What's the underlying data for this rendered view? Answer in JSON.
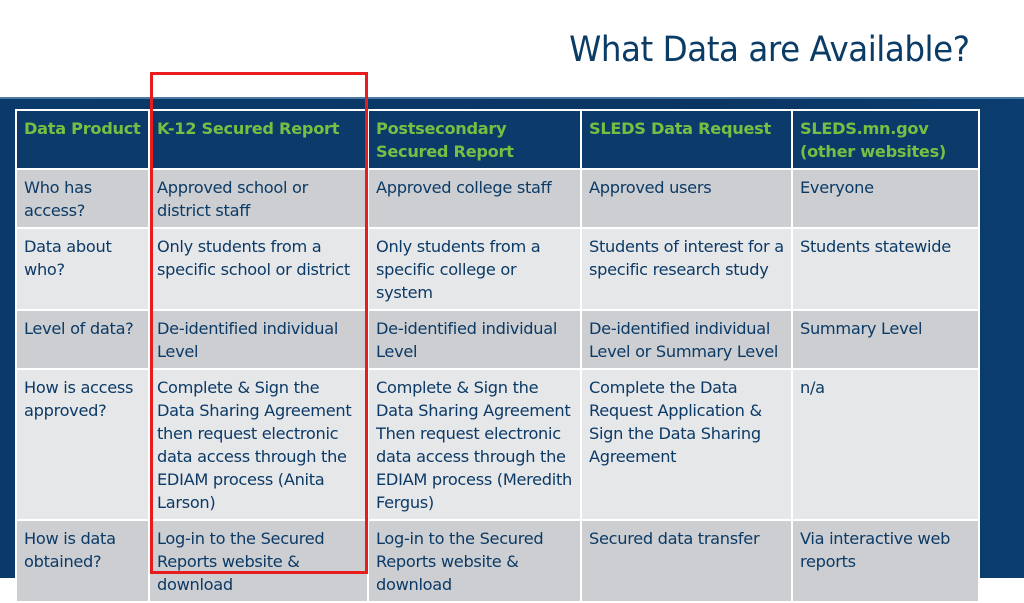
{
  "slide": {
    "title": "What Data are Available?"
  },
  "colors": {
    "title_text": "#0b3c66",
    "band_background": "#0a3a6a",
    "header_text": "#75c043",
    "body_text": "#0c3a66",
    "row_dark": "#ccced1",
    "row_light": "#e6e7e9",
    "highlight_border": "#e81c1c"
  },
  "table": {
    "headers": [
      "Data Product",
      "K-12 Secured Report",
      "Postsecondary Secured Report",
      "SLEDS Data Request",
      "SLEDS.mn.gov (other websites)"
    ],
    "rows": [
      {
        "label": "Who has access?",
        "cells": [
          "Approved school or district staff",
          "Approved college staff",
          "Approved users",
          "Everyone"
        ]
      },
      {
        "label": "Data about who?",
        "cells": [
          "Only students from a specific school or district",
          "Only students from a specific college or system",
          "Students of interest for a specific research study",
          "Students statewide"
        ]
      },
      {
        "label": "Level of data?",
        "cells": [
          "De-identified individual Level",
          "De-identified individual Level",
          "De-identified individual Level or Summary Level",
          "Summary Level"
        ]
      },
      {
        "label": "How is access approved?",
        "cells": [
          "Complete & Sign the Data Sharing Agreement then request electronic data access through the EDIAM process (Anita Larson)",
          "Complete & Sign the Data Sharing Agreement Then request electronic data access through the EDIAM process (Meredith Fergus)",
          "Complete the Data Request Application & Sign the Data Sharing Agreement",
          "n/a"
        ]
      },
      {
        "label": "How is data obtained?",
        "cells": [
          "Log-in to the Secured Reports website & download",
          "Log-in to the Secured Reports website & download",
          "Secured data transfer",
          "Via interactive web reports"
        ]
      }
    ],
    "highlighted_column": "K-12 Secured Report"
  }
}
